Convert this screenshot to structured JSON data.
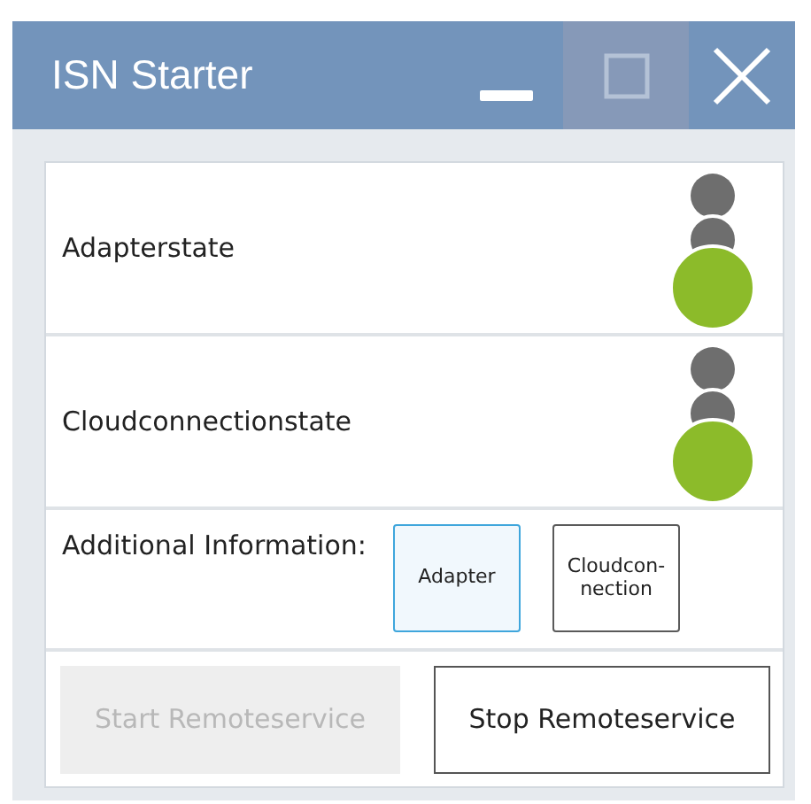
{
  "window": {
    "title": "ISN Starter",
    "controls": [
      {
        "kind": "minimize",
        "hovered": false
      },
      {
        "kind": "maximize",
        "hovered": true
      },
      {
        "kind": "close",
        "hovered": false
      }
    ]
  },
  "states": [
    {
      "label": "Adapterstate",
      "lights": [
        {
          "active": false,
          "color": "#6e6e6e"
        },
        {
          "active": false,
          "color": "#6e6e6e"
        },
        {
          "active": true,
          "color": "#8cbb2a"
        }
      ]
    },
    {
      "label": "Cloudconnectionstate",
      "lights": [
        {
          "active": false,
          "color": "#6e6e6e"
        },
        {
          "active": false,
          "color": "#6e6e6e"
        },
        {
          "active": true,
          "color": "#8cbb2a"
        }
      ]
    }
  ],
  "additional_information": {
    "label": "Additional Information:",
    "buttons": [
      {
        "label": "Adapter",
        "selected": true
      },
      {
        "label": "Cloudcon-\nnection",
        "selected": false
      }
    ]
  },
  "actions": [
    {
      "label": "Start Remoteservice",
      "disabled": true
    },
    {
      "label": "Stop Remoteservice",
      "disabled": false
    }
  ]
}
